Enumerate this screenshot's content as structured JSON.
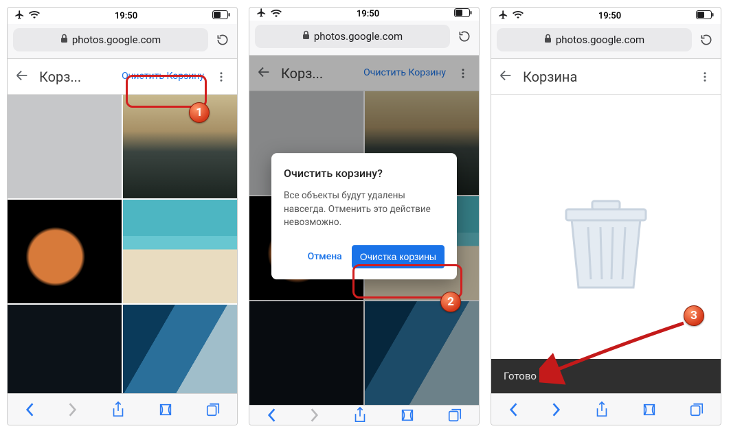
{
  "status": {
    "time": "19:50"
  },
  "addr": {
    "url": "photos.google.com"
  },
  "shot1": {
    "header": {
      "title": "Корз...",
      "clear": "Очистить Корзину"
    }
  },
  "shot2": {
    "header": {
      "title": "Корз...",
      "clear": "Очистить Корзину"
    },
    "dialog": {
      "title": "Очистить корзину?",
      "body": "Все объекты будут удалены навсегда. Отменить это действие невозможно.",
      "cancel": "Отмена",
      "confirm": "Очистка корзины"
    }
  },
  "shot3": {
    "header": {
      "title": "Корзина"
    },
    "toast": "Готово"
  },
  "callouts": {
    "one": "1",
    "two": "2",
    "three": "3"
  }
}
